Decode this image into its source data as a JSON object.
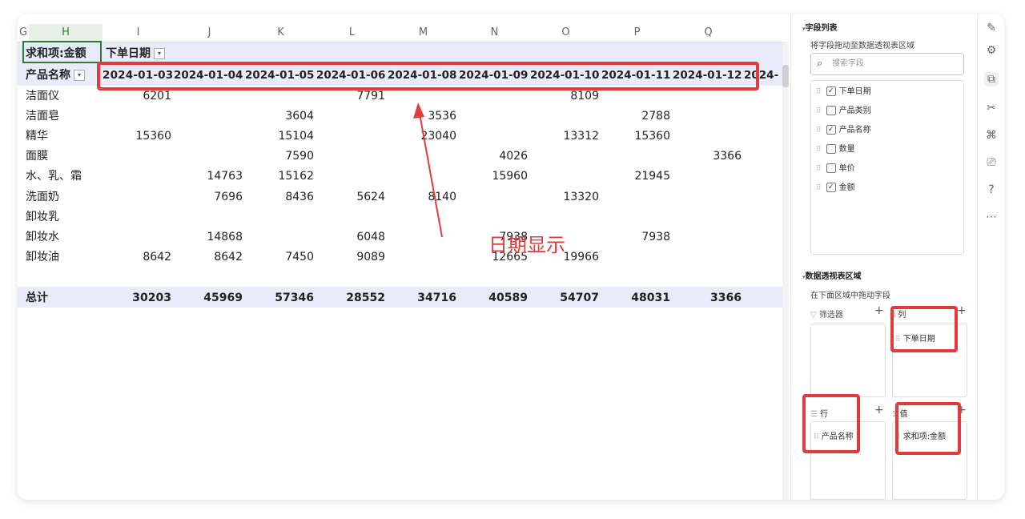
{
  "columns": [
    "H",
    "I",
    "J",
    "K",
    "L",
    "M",
    "N",
    "O",
    "P",
    "Q"
  ],
  "col_prefix": "G",
  "pivot": {
    "corner_label": "求和项:金额",
    "col_field": "下单日期",
    "row_field": "产品名称",
    "dates": [
      "2024-01-03",
      "2024-01-04",
      "2024-01-05",
      "2024-01-06",
      "2024-01-08",
      "2024-01-09",
      "2024-01-10",
      "2024-01-11",
      "2024-01-12",
      "2024-"
    ],
    "rows": [
      {
        "name": "洁面仪",
        "values": [
          "6201",
          "",
          "",
          "7791",
          "",
          "",
          "8109",
          "",
          ""
        ]
      },
      {
        "name": "洁面皂",
        "values": [
          "",
          "",
          "3604",
          "",
          "3536",
          "",
          "",
          "2788",
          ""
        ]
      },
      {
        "name": "精华",
        "values": [
          "15360",
          "",
          "15104",
          "",
          "23040",
          "",
          "13312",
          "15360",
          ""
        ]
      },
      {
        "name": "面膜",
        "values": [
          "",
          "",
          "7590",
          "",
          "",
          "4026",
          "",
          "",
          "3366"
        ]
      },
      {
        "name": "水、乳、霜",
        "values": [
          "",
          "14763",
          "15162",
          "",
          "",
          "15960",
          "",
          "21945",
          ""
        ]
      },
      {
        "name": "洗面奶",
        "values": [
          "",
          "7696",
          "8436",
          "5624",
          "8140",
          "",
          "13320",
          "",
          ""
        ]
      },
      {
        "name": "卸妆乳",
        "values": [
          "",
          "",
          "",
          "",
          "",
          "",
          "",
          "",
          ""
        ]
      },
      {
        "name": "卸妆水",
        "values": [
          "",
          "14868",
          "",
          "6048",
          "",
          "7938",
          "",
          "7938",
          ""
        ]
      },
      {
        "name": "卸妆油",
        "values": [
          "8642",
          "8642",
          "7450",
          "9089",
          "",
          "12665",
          "19966",
          "",
          ""
        ]
      }
    ],
    "total": {
      "name": "总计",
      "values": [
        "30203",
        "45969",
        "57346",
        "28552",
        "34716",
        "40589",
        "54707",
        "48031",
        "3366"
      ]
    }
  },
  "annotation": "日期显示",
  "panel": {
    "field_list_title": "字段列表",
    "field_list_hint": "将字段拖动至数据透视表区域",
    "search_placeholder": "搜索字段",
    "fields": [
      {
        "label": "下单日期",
        "checked": true
      },
      {
        "label": "产品类别",
        "checked": false
      },
      {
        "label": "产品名称",
        "checked": true
      },
      {
        "label": "数量",
        "checked": false
      },
      {
        "label": "单价",
        "checked": false
      },
      {
        "label": "金额",
        "checked": true
      }
    ],
    "areas_title": "数据透视表区域",
    "areas_hint": "在下面区域中拖动字段",
    "filter_label": "筛选器",
    "columns_label": "列",
    "columns_item": "下单日期",
    "rows_label": "行",
    "rows_item": "产品名称",
    "values_label": "值",
    "values_item": "求和项:金额"
  },
  "colors": {
    "accent_red": "#e23b3b",
    "header_band": "#e9ecf8",
    "selection_green": "#2e7d32"
  }
}
